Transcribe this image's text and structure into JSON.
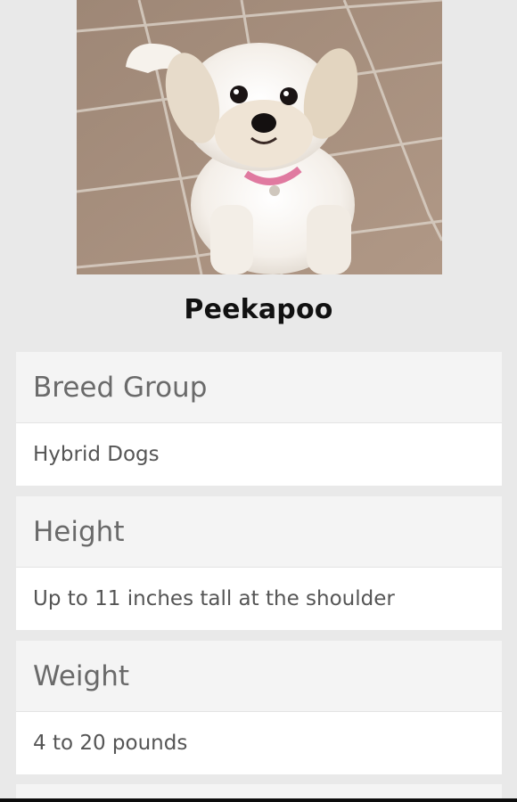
{
  "breed": {
    "name": "Peekapoo"
  },
  "details": [
    {
      "label": "Breed Group",
      "value": "Hybrid Dogs"
    },
    {
      "label": "Height",
      "value": "Up to 11 inches tall at the shoulder"
    },
    {
      "label": "Weight",
      "value": "4 to 20 pounds"
    }
  ],
  "colors": {
    "background": "#e9e9e9",
    "card_header": "#f4f4f4",
    "card_body": "#ffffff",
    "label_text": "#6a6a6a",
    "value_text": "#555555",
    "title_text": "#111111"
  }
}
